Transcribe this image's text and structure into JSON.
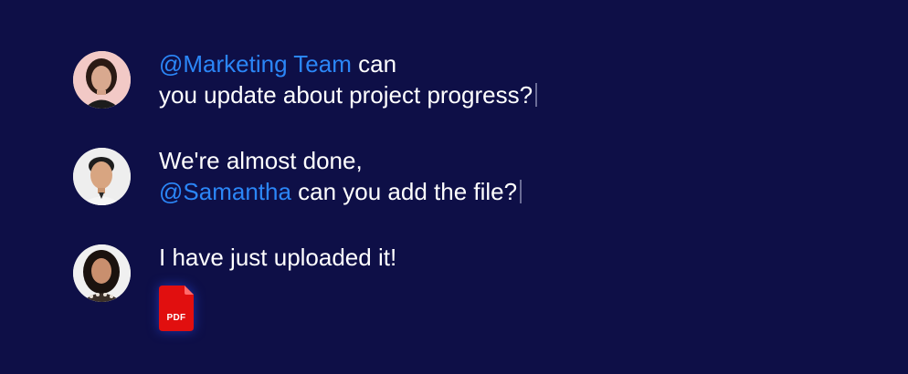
{
  "messages": [
    {
      "avatar": "avatar-woman-1",
      "mention_line1": "@Marketing Team",
      "text_line1": " can",
      "text_line2": "you update about project progress?"
    },
    {
      "avatar": "avatar-man",
      "text_line1": "We're almost done,",
      "mention_line2": "@Samantha",
      "text_line2": " can you add the file?"
    },
    {
      "avatar": "avatar-woman-2",
      "text_line1": "I have just uploaded it!",
      "attachment": {
        "type": "pdf",
        "label": "PDF",
        "icon": "pdf-file-icon"
      }
    }
  ],
  "colors": {
    "background": "#0e0f47",
    "text": "#ffffff",
    "mention": "#2b86f7",
    "pdf": "#e10f0f"
  }
}
